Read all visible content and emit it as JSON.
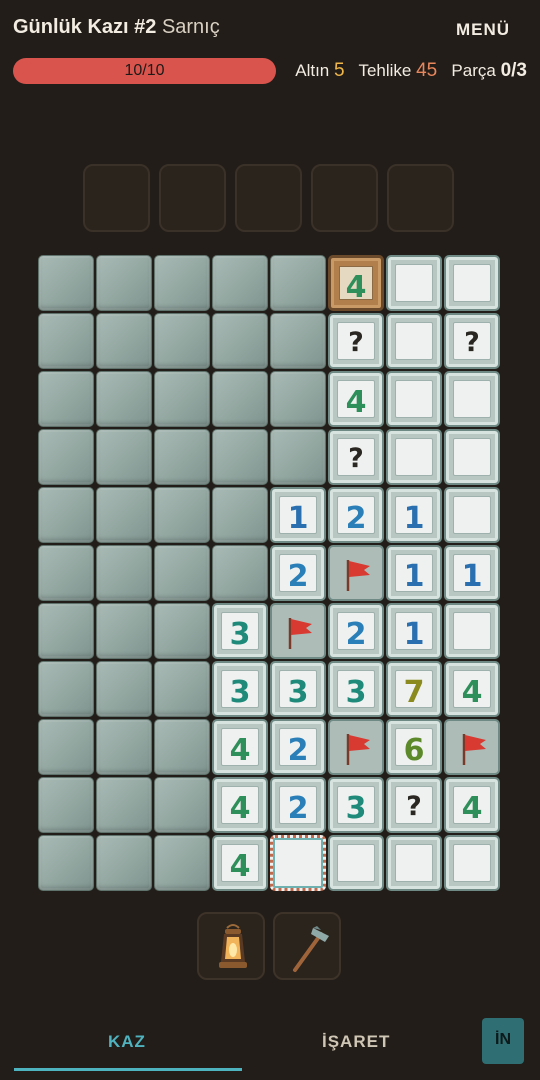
{
  "header": {
    "title": "Günlük Kazı #2",
    "subtitle": "Sarnıç",
    "menu_label": "MENÜ"
  },
  "status": {
    "health_text": "10/10",
    "health_fraction": 1.0,
    "gold_label": "Altın",
    "gold_value": "5",
    "danger_label": "Tehlike",
    "danger_value": "45",
    "parts_label": "Parça",
    "parts_value": "0/3"
  },
  "inventory_slots": 5,
  "board": {
    "cols": 8,
    "rows": 11,
    "cells": [
      [
        "S",
        "S",
        "S",
        "S",
        "S",
        "W:4",
        "O",
        "O"
      ],
      [
        "S",
        "S",
        "S",
        "S",
        "S",
        "O:?",
        "O",
        "O:?"
      ],
      [
        "S",
        "S",
        "S",
        "S",
        "S",
        "O:4",
        "O",
        "O"
      ],
      [
        "S",
        "S",
        "S",
        "S",
        "S",
        "O:?",
        "O",
        "O"
      ],
      [
        "S",
        "S",
        "S",
        "S",
        "O:1",
        "O:2",
        "O:1",
        "O"
      ],
      [
        "S",
        "S",
        "S",
        "S",
        "O:2",
        "F",
        "O:1",
        "O:1"
      ],
      [
        "S",
        "S",
        "S",
        "O:3",
        "F",
        "O:2",
        "O:1",
        "O"
      ],
      [
        "S",
        "S",
        "S",
        "O:3",
        "O:3",
        "O:3",
        "O:7",
        "O:4"
      ],
      [
        "S",
        "S",
        "S",
        "O:4",
        "O:2",
        "F",
        "O:6",
        "F"
      ],
      [
        "S",
        "S",
        "S",
        "O:4",
        "O:2",
        "O:3",
        "O:?",
        "O:4"
      ],
      [
        "S",
        "S",
        "S",
        "O:4",
        "B",
        "O",
        "O",
        "O"
      ]
    ],
    "number_colors": {
      "1": "#2a6fb0",
      "2": "#2a7fb8",
      "3": "#1f8a7a",
      "4": "#2f8f5a",
      "6": "#5c8a2a",
      "7": "#8a8a1f"
    }
  },
  "tools": [
    {
      "name": "lantern-icon"
    },
    {
      "name": "pickaxe-icon"
    }
  ],
  "tabs": {
    "dig_label": "KAZ",
    "mark_label": "İŞARET",
    "in_label": "İN"
  }
}
